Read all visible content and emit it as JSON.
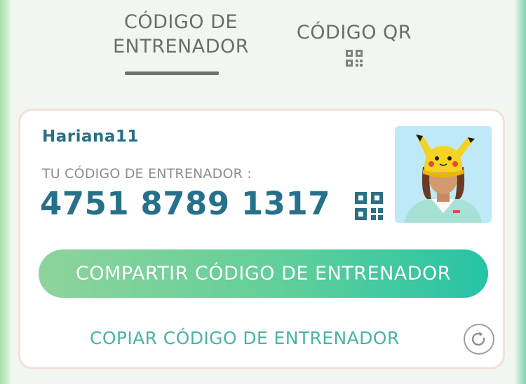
{
  "tabs": {
    "trainer_code_line1": "CÓDIGO DE",
    "trainer_code_line2": "ENTRENADOR",
    "qr_code": "CÓDIGO QR",
    "qr_icon": "qr-code-icon"
  },
  "card": {
    "username": "Hariana11",
    "code_label": "TU CÓDIGO DE ENTRENADOR :",
    "code_value": "4751 8789 1317",
    "qr_icon": "qr-code-icon",
    "avatar_icon": "trainer-avatar-pikachu-hat"
  },
  "actions": {
    "share_label": "COMPARTIR CÓDIGO DE ENTRENADOR",
    "copy_label": "COPIAR CÓDIGO DE ENTRENADOR",
    "refresh_icon": "refresh-icon"
  },
  "colors": {
    "accent_teal": "#27708a",
    "share_gradient_start": "#8fd39b",
    "share_gradient_end": "#26c3a6",
    "copy_text": "#4ab3a5"
  }
}
